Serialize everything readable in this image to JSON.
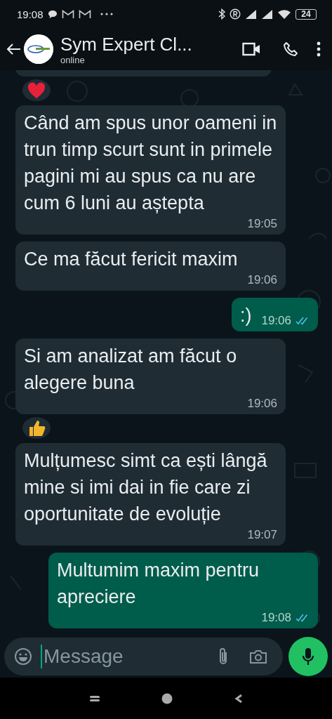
{
  "status_bar": {
    "time": "19:08",
    "battery": "24"
  },
  "header": {
    "title": "Sym Expert Cl...",
    "subtitle": "online"
  },
  "messages": [
    {
      "kind": "incoming-partial"
    },
    {
      "kind": "heart-reaction"
    },
    {
      "kind": "incoming",
      "text": "Când am spus unor oameni in trun timp scurt sunt in primele pagini mi au spus ca nu are cum 6 luni au aștepta",
      "time": "19:05"
    },
    {
      "kind": "incoming",
      "text": "Ce ma făcut fericit maxim",
      "time": "19:06"
    },
    {
      "kind": "outgoing",
      "text": ":)",
      "time": "19:06",
      "read": true
    },
    {
      "kind": "incoming",
      "text": "Si am analizat am făcut o alegere buna",
      "time": "19:06"
    },
    {
      "kind": "thumbs-up-reaction"
    },
    {
      "kind": "incoming",
      "text": "Mulțumesc simt ca ești lângă mine si imi dai in fie care zi oportunitate de evoluție",
      "time": "19:07"
    },
    {
      "kind": "outgoing",
      "text": "Multumim maxim pentru apreciere",
      "time": "19:08",
      "read": true
    }
  ],
  "composer": {
    "placeholder": "Message"
  }
}
